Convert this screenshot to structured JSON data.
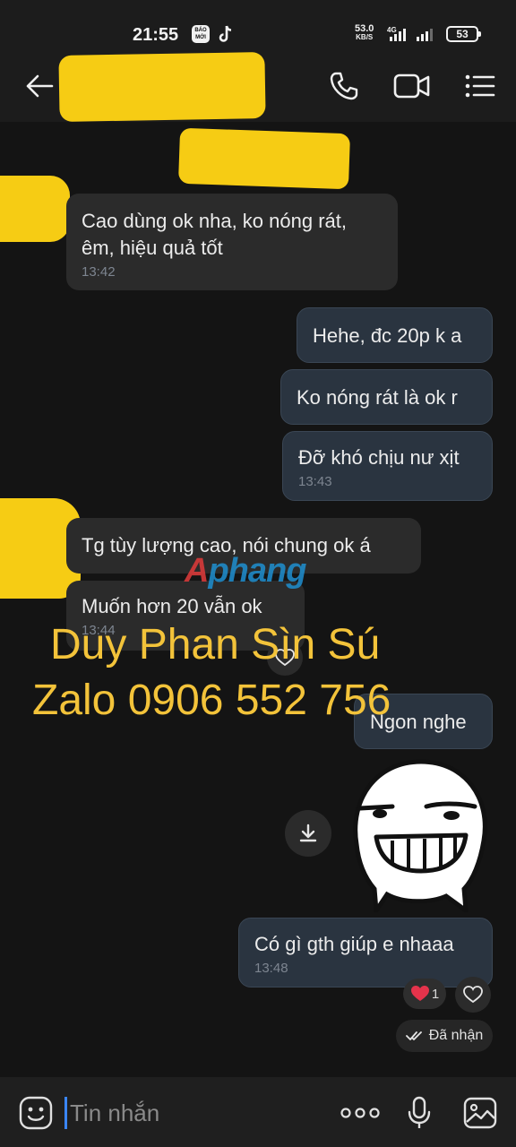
{
  "status_bar": {
    "time": "21:55",
    "news_icon_label": "BÁO MỚI",
    "net_speed": "53.0",
    "net_speed_unit": "KB/S",
    "network": "4G",
    "battery": "53"
  },
  "header": {
    "contact_name": "",
    "icons": [
      "back-arrow-icon",
      "phone-icon",
      "video-camera-icon",
      "menu-icon"
    ]
  },
  "messages": [
    {
      "side": "in",
      "text_lines": [
        "Cao dùng ok nha, ko nóng rát,",
        "êm, hiệu quả tốt"
      ],
      "time": "13:42"
    },
    {
      "side": "out",
      "text": "Hehe, đc 20p k a"
    },
    {
      "side": "out",
      "text": "Ko nóng rát là ok r"
    },
    {
      "side": "out",
      "text": "Đỡ khó chịu nư xịt",
      "time": "13:43"
    },
    {
      "side": "in",
      "text": "Tg tùy lượng cao, nói chung ok á"
    },
    {
      "side": "in",
      "text": "Muốn hơn 20 vẫn ok",
      "time": "13:44"
    },
    {
      "side": "out",
      "text": "Ngon nghe"
    },
    {
      "side": "out",
      "type": "sticker",
      "sticker": "smug-face-sticker"
    },
    {
      "side": "out",
      "text": "Có gì gth giúp e nhaaa",
      "time": "13:48"
    }
  ],
  "overlay": {
    "logo_first": "A",
    "logo_rest": "phang",
    "watermark_line1": "Duy Phan Sìn Sú",
    "watermark_line2": "Zalo 0906 552 756"
  },
  "reactions": {
    "heart_count": "1",
    "delivery_status": "Đã nhận"
  },
  "composer": {
    "placeholder": "Tin nhắn",
    "more_label": "ooo"
  },
  "colors": {
    "background": "#141414",
    "incoming_bubble": "#2b2b2b",
    "outgoing_bubble": "#2a3440",
    "watermark": "#f3c33a",
    "redaction": "#f6cc14"
  }
}
